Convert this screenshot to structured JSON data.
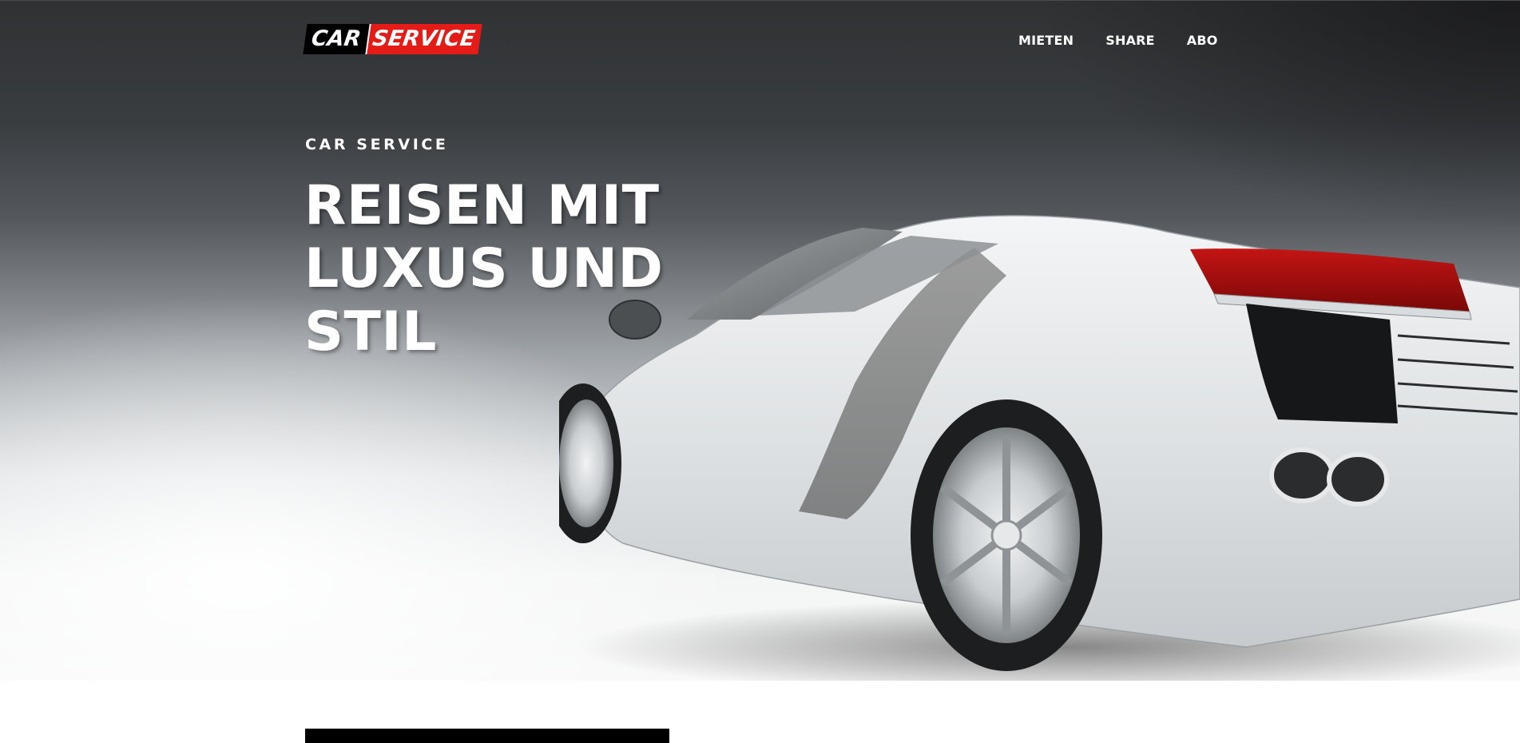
{
  "brand": {
    "logo_part1": "CAR",
    "logo_part2": "SERVICE",
    "logo_colors": {
      "part1_bg": "#000000",
      "part2_bg": "#e41b17",
      "text": "#ffffff"
    }
  },
  "nav": {
    "items": [
      {
        "label": "MIETEN"
      },
      {
        "label": "SHARE"
      },
      {
        "label": "ABO"
      }
    ]
  },
  "hero": {
    "eyebrow": "CAR SERVICE",
    "headline_line1": "REISEN MIT",
    "headline_line2": "LUXUS UND",
    "headline_line3": "STIL",
    "image": "white-sports-car-rear-three-quarter"
  },
  "colors": {
    "accent": "#e41b17",
    "hero_dark": "#2f3133",
    "text_light": "#ffffff"
  }
}
